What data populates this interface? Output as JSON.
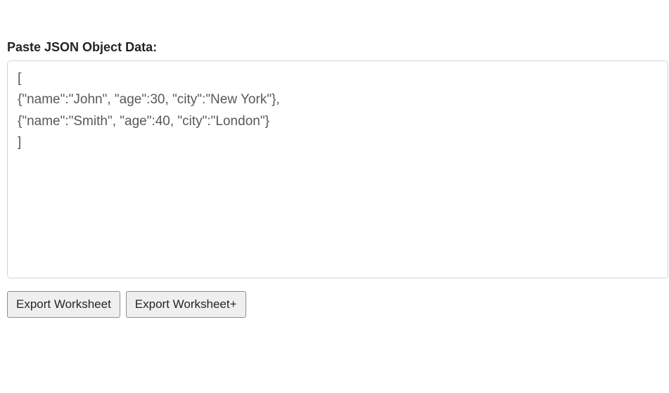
{
  "label": "Paste JSON Object Data:",
  "textarea_value": "[\n{\"name\":\"John\", \"age\":30, \"city\":\"New York\"},\n{\"name\":\"Smith\", \"age\":40, \"city\":\"London\"}\n]",
  "buttons": {
    "export": "Export Worksheet",
    "export_plus": "Export Worksheet+"
  }
}
